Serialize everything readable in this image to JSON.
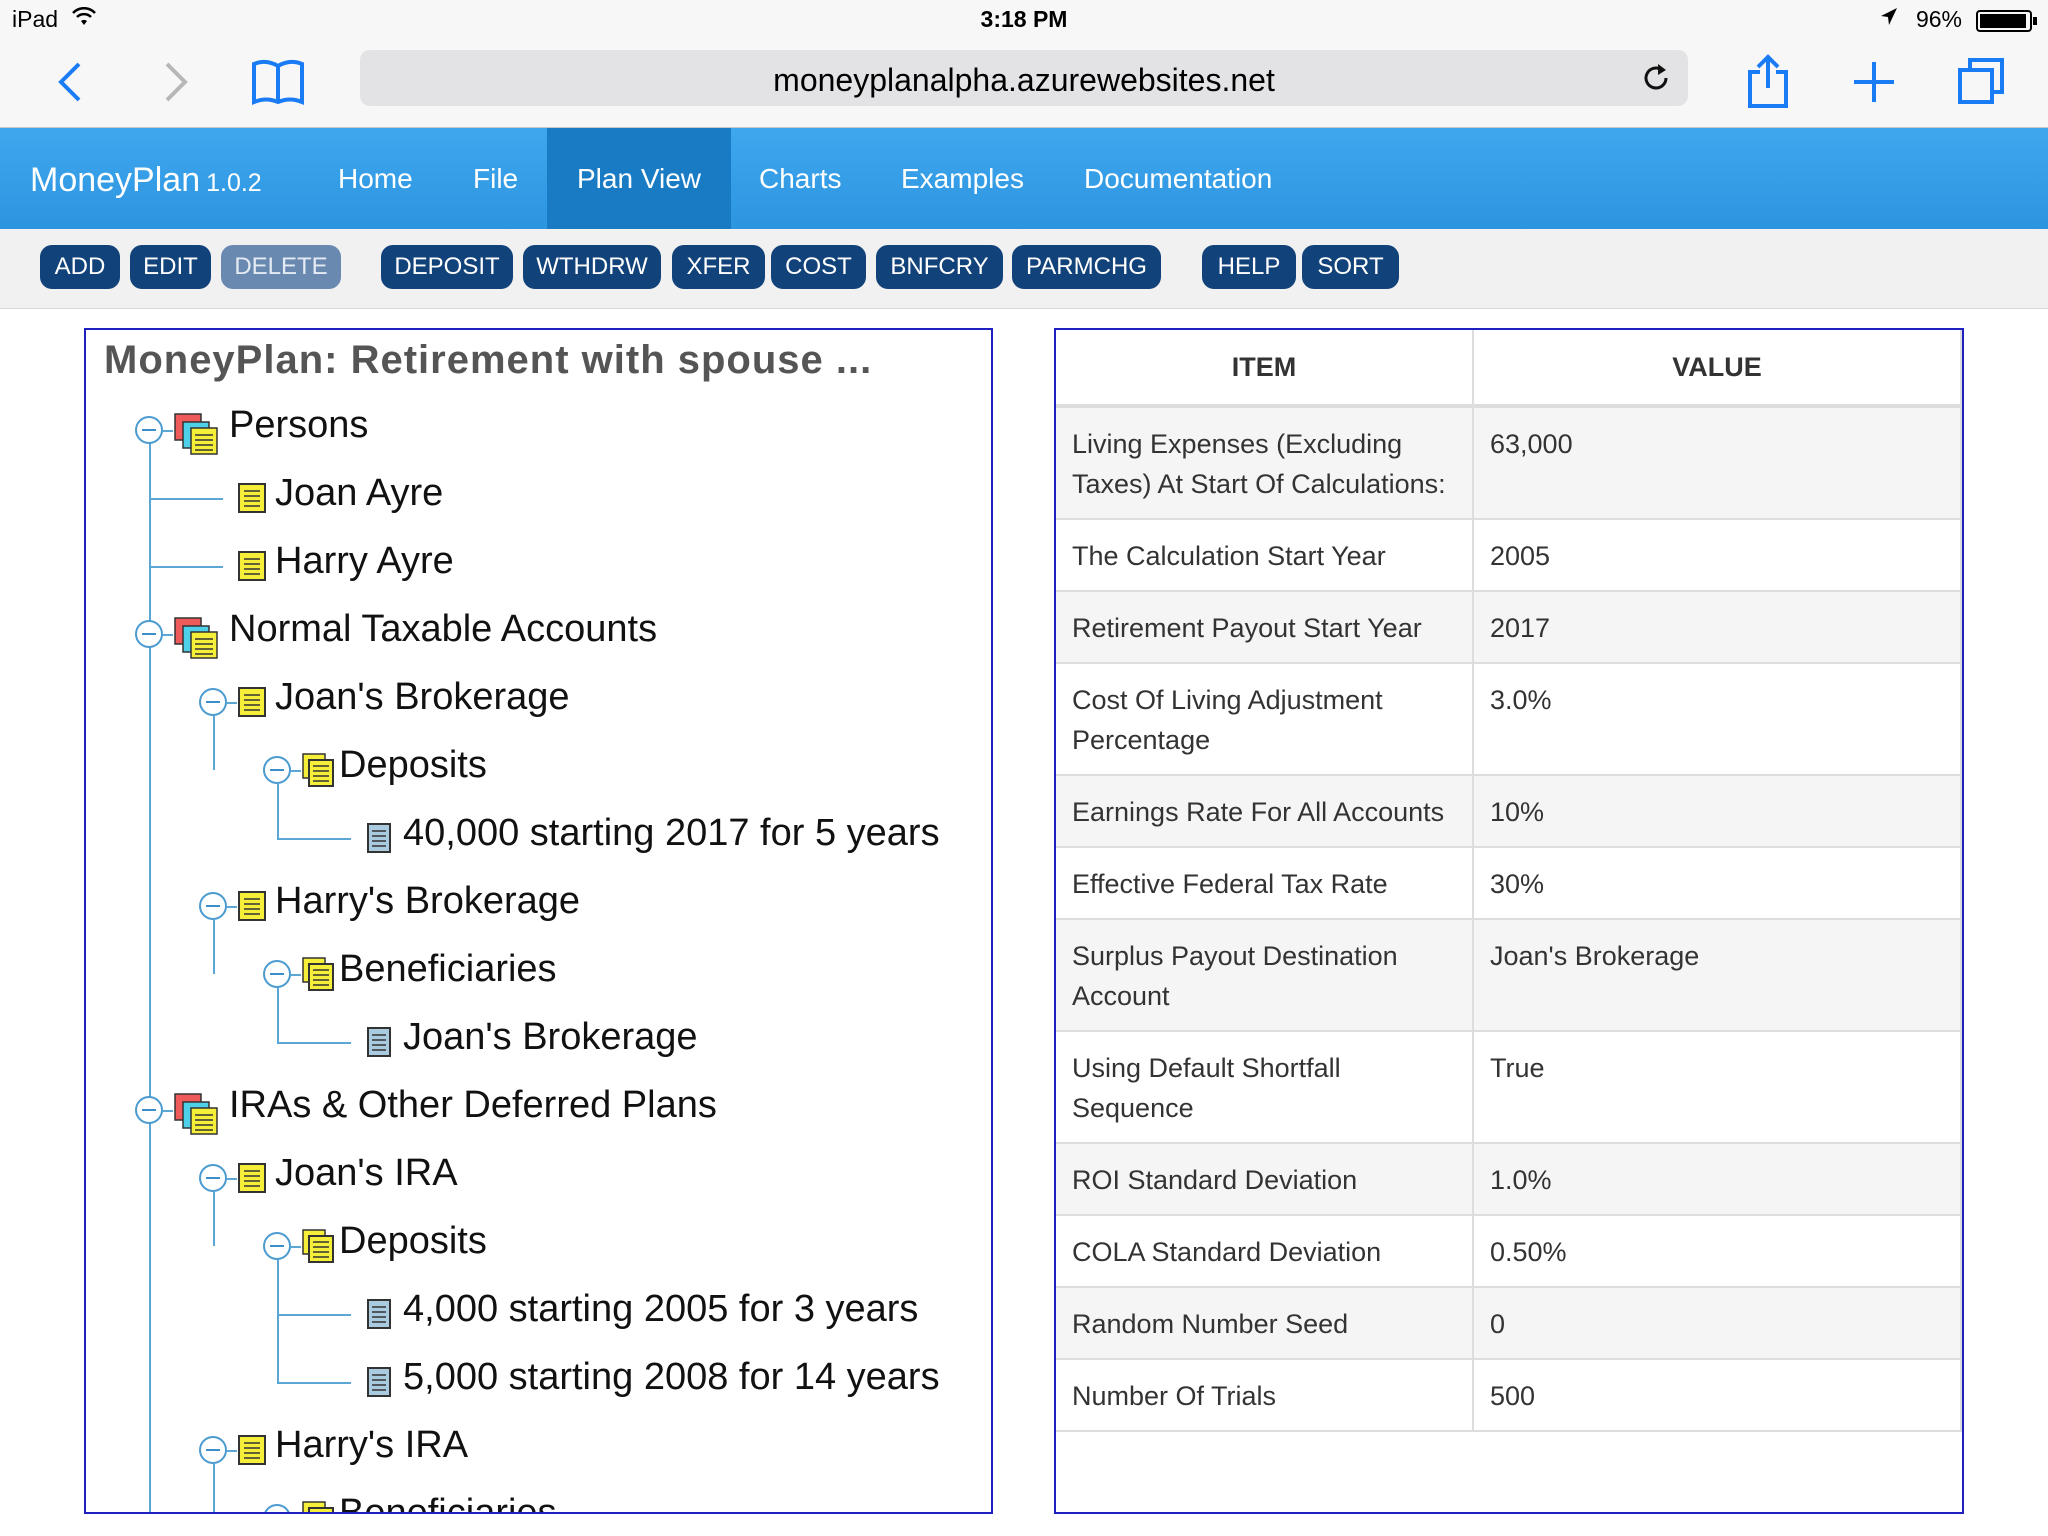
{
  "status_bar": {
    "device": "iPad",
    "time": "3:18 PM",
    "battery": "96%",
    "battery_level": 0.96
  },
  "browser": {
    "url": "moneyplanalpha.azurewebsites.net"
  },
  "app": {
    "brand": "MoneyPlan",
    "version": "1.0.2",
    "nav": [
      "Home",
      "File",
      "Plan View",
      "Charts",
      "Examples",
      "Documentation"
    ],
    "active_nav": "Plan View"
  },
  "toolbar": {
    "buttons": [
      "ADD",
      "EDIT",
      "DELETE",
      "DEPOSIT",
      "WTHDRW",
      "XFER",
      "COST",
      "BNFCRY",
      "PARMCHG",
      "HELP",
      "SORT"
    ],
    "disabled": [
      "DELETE"
    ]
  },
  "tree": {
    "title": "MoneyPlan: Retirement with spouse ...",
    "nodes": [
      {
        "label": "Persons",
        "icon": "group-folder-icon"
      },
      {
        "label": "Joan Ayre",
        "icon": "person-note-icon"
      },
      {
        "label": "Harry Ayre",
        "icon": "person-note-icon"
      },
      {
        "label": "Normal Taxable Accounts",
        "icon": "group-folder-icon"
      },
      {
        "label": "Joan's Brokerage",
        "icon": "account-note-icon"
      },
      {
        "label": "Deposits",
        "icon": "list-folder-icon"
      },
      {
        "label": "40,000 starting 2017 for 5 years",
        "icon": "entry-doc-icon"
      },
      {
        "label": "Harry's Brokerage",
        "icon": "account-note-icon"
      },
      {
        "label": "Beneficiaries",
        "icon": "list-folder-icon"
      },
      {
        "label": "Joan's Brokerage",
        "icon": "entry-doc-icon"
      },
      {
        "label": "IRAs & Other Deferred Plans",
        "icon": "group-folder-icon"
      },
      {
        "label": "Joan's IRA",
        "icon": "account-note-icon"
      },
      {
        "label": "Deposits",
        "icon": "list-folder-icon"
      },
      {
        "label": "4,000 starting 2005 for 3 years",
        "icon": "entry-doc-icon"
      },
      {
        "label": "5,000 starting 2008 for 14 years",
        "icon": "entry-doc-icon"
      },
      {
        "label": "Harry's IRA",
        "icon": "account-note-icon"
      },
      {
        "label": "Beneficiaries",
        "icon": "list-folder-icon"
      }
    ]
  },
  "table": {
    "headers": [
      "ITEM",
      "VALUE"
    ],
    "rows": [
      [
        "Living Expenses (Excluding Taxes) At Start Of Calculations:",
        "63,000"
      ],
      [
        "The Calculation Start Year",
        "2005"
      ],
      [
        "Retirement Payout Start Year",
        "2017"
      ],
      [
        "Cost Of Living Adjustment Percentage",
        "3.0%"
      ],
      [
        "Earnings Rate For All Accounts",
        "10%"
      ],
      [
        "Effective Federal Tax Rate",
        "30%"
      ],
      [
        "Surplus Payout Destination Account",
        "Joan's Brokerage"
      ],
      [
        "Using Default Shortfall Sequence",
        "True"
      ],
      [
        "ROI Standard Deviation",
        "1.0%"
      ],
      [
        "COLA Standard Deviation",
        "0.50%"
      ],
      [
        "Random Number Seed",
        "0"
      ],
      [
        "Number Of Trials",
        "500"
      ]
    ]
  }
}
